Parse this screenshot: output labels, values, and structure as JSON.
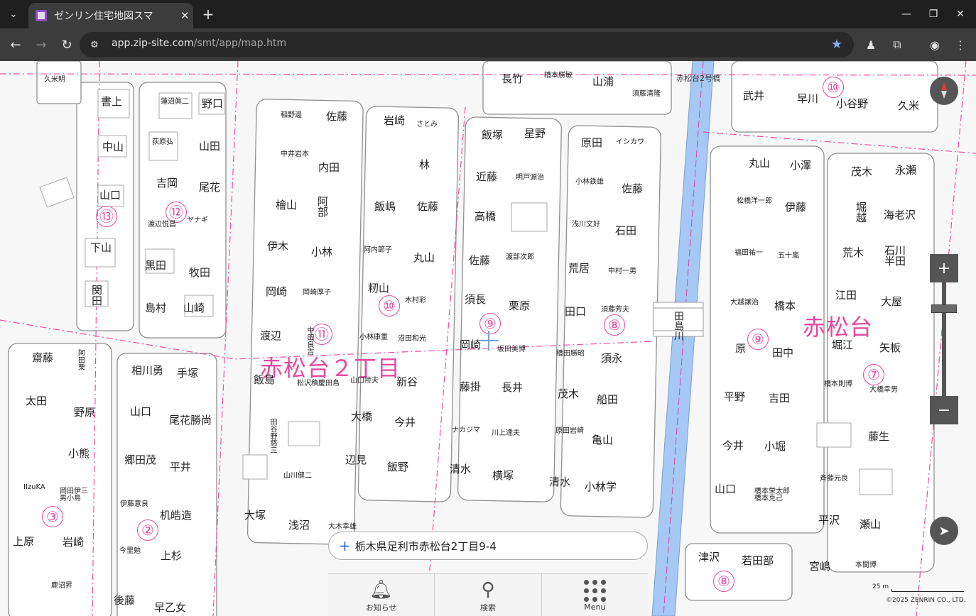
{
  "browser": {
    "tab_title": "ゼンリン住宅地図スマ",
    "url_domain": "app.zip-site.com",
    "url_path": "/smt/app/map.htm"
  },
  "map": {
    "district_label": "赤松台２丁目",
    "district_label_right": "赤松台",
    "river_label": "田島川",
    "bridge_label": "赤松台2号橋",
    "block_numbers": [
      "⑬",
      "⑫",
      "⑪",
      "⑩",
      "⑨",
      "⑧",
      "⑩",
      "⑨",
      "⑦",
      "③",
      "②",
      "⑧"
    ],
    "names": [
      "久米明",
      "書上",
      "中山",
      "山口",
      "下山",
      "関田",
      "蓮沼眞二",
      "野口",
      "荻原弘",
      "山田",
      "吉岡",
      "尾花",
      "渡辺悦昌",
      "ヤナギ",
      "黒田",
      "牧田",
      "島村",
      "山崎",
      "稲野邊",
      "佐藤",
      "中井岩本",
      "内田",
      "檜山",
      "阿部",
      "伊木",
      "小林",
      "岡崎",
      "岡崎厚子",
      "渡辺",
      "中田良吉",
      "飯島",
      "松沢積慶田島",
      "田谷野慈三",
      "山川健二",
      "大塚",
      "浅沼",
      "大木幸雄",
      "岩崎",
      "さとみ",
      "飯嶋",
      "林",
      "佐藤",
      "阿内節子",
      "丸山",
      "籾山",
      "木村彩",
      "小林康重",
      "沼田和光",
      "山口陸夫",
      "新谷",
      "大橋",
      "今井",
      "辺見",
      "飯野",
      "飯塚",
      "星野",
      "近藤",
      "明戸源治",
      "高橋",
      "佐藤",
      "渡部次郎",
      "須長",
      "栗原",
      "岡崎",
      "坂田美博",
      "藤掛",
      "長井",
      "ナカジマ",
      "川上達夫",
      "清水",
      "横塚",
      "原田",
      "イシカワ",
      "小林鉄雄",
      "佐藤",
      "浅川文好",
      "石田",
      "荒居",
      "中村一男",
      "田口",
      "須藤芳夫",
      "橋田勝昭",
      "須永",
      "茂木",
      "船田",
      "原田岩崎",
      "亀山",
      "清水",
      "小林学",
      "長竹",
      "橋本勝敏",
      "山浦",
      "須藤清隆",
      "武井",
      "早川",
      "小谷野",
      "久米",
      "丸山",
      "小澤",
      "松橋洋一郎",
      "伊藤",
      "福田祐一",
      "五十嵐",
      "大越譲治",
      "橋本",
      "原",
      "田中",
      "平野",
      "吉田",
      "今井",
      "小堀",
      "山口",
      "橋本栄太郎橋本克己",
      "津沢",
      "若田部",
      "茂木",
      "永瀬",
      "堀越",
      "海老沢",
      "荒木",
      "石川半田",
      "江田",
      "大屋",
      "堀江",
      "矢板",
      "橋本則博",
      "大橋幸男",
      "藤生",
      "斉藤元良",
      "平沢",
      "瀬山",
      "宮嶋",
      "本間博",
      "齋藤",
      "阿田栗",
      "太田",
      "野原",
      "小熊",
      "IIzuKA",
      "岡田伊三男小島",
      "上原",
      "岩崎",
      "鹿沼昇",
      "相川勇",
      "手塚",
      "山口",
      "尾花勝尚",
      "郷田茂",
      "平井",
      "伊藤意良",
      "机皓造",
      "今里勉",
      "上杉",
      "後藤",
      "早乙女"
    ]
  },
  "search": {
    "address": "栃木県足利市赤松台2丁目9-4"
  },
  "menu": {
    "items": [
      {
        "label": "お知らせ",
        "icon": "bell-icon"
      },
      {
        "label": "検索",
        "icon": "search-icon"
      },
      {
        "label": "Menu",
        "icon": "grid-icon"
      }
    ]
  },
  "scale_label": "25 m",
  "copyright": "©2025 ZENRIN CO., LTD."
}
